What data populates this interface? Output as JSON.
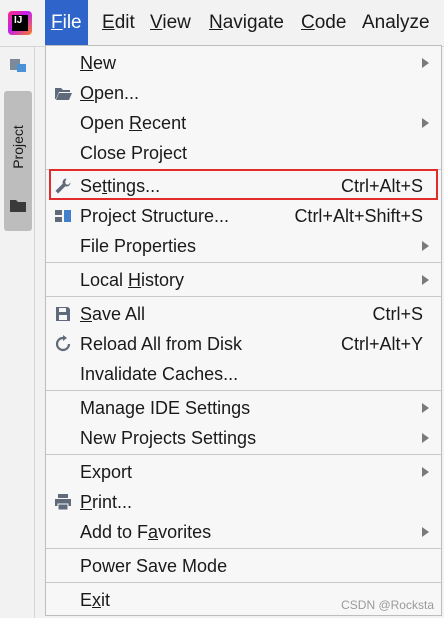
{
  "menubar": {
    "items": [
      {
        "label": "F",
        "rest": "ile",
        "active": true
      },
      {
        "label": "E",
        "rest": "dit",
        "active": false
      },
      {
        "label": "V",
        "rest": "iew",
        "active": false
      },
      {
        "label": "N",
        "rest": "avigate",
        "active": false
      },
      {
        "label": "C",
        "rest": "ode",
        "active": false
      },
      {
        "label": "",
        "rest": "Analyze",
        "active": false
      }
    ]
  },
  "sidebar": {
    "project_tab_label": "Project"
  },
  "file_menu": {
    "items": [
      {
        "pre": "",
        "mn": "N",
        "post": "ew",
        "shortcut": "",
        "submenu": true,
        "icon": ""
      },
      {
        "pre": "",
        "mn": "O",
        "post": "pen...",
        "shortcut": "",
        "submenu": false,
        "icon": "open-folder-icon"
      },
      {
        "pre": "Open ",
        "mn": "R",
        "post": "ecent",
        "shortcut": "",
        "submenu": true,
        "icon": ""
      },
      {
        "pre": "Close Project",
        "mn": "",
        "post": "",
        "shortcut": "",
        "submenu": false,
        "icon": ""
      },
      {
        "pre": "Se",
        "mn": "t",
        "post": "tings...",
        "shortcut": "Ctrl+Alt+S",
        "submenu": false,
        "icon": "wrench-icon"
      },
      {
        "pre": "Project Structure...",
        "mn": "",
        "post": "",
        "shortcut": "Ctrl+Alt+Shift+S",
        "submenu": false,
        "icon": "project-structure-icon"
      },
      {
        "pre": "File Properties",
        "mn": "",
        "post": "",
        "shortcut": "",
        "submenu": true,
        "icon": ""
      },
      {
        "pre": "Local ",
        "mn": "H",
        "post": "istory",
        "shortcut": "",
        "submenu": true,
        "icon": ""
      },
      {
        "pre": "",
        "mn": "S",
        "post": "ave All",
        "shortcut": "Ctrl+S",
        "submenu": false,
        "icon": "save-icon"
      },
      {
        "pre": "Reload All from Disk",
        "mn": "",
        "post": "",
        "shortcut": "Ctrl+Alt+Y",
        "submenu": false,
        "icon": "reload-icon"
      },
      {
        "pre": "Invalidate Caches...",
        "mn": "",
        "post": "",
        "shortcut": "",
        "submenu": false,
        "icon": ""
      },
      {
        "pre": "Manage IDE Settings",
        "mn": "",
        "post": "",
        "shortcut": "",
        "submenu": true,
        "icon": ""
      },
      {
        "pre": "New Projects Settings",
        "mn": "",
        "post": "",
        "shortcut": "",
        "submenu": true,
        "icon": ""
      },
      {
        "pre": "Export",
        "mn": "",
        "post": "",
        "shortcut": "",
        "submenu": true,
        "icon": ""
      },
      {
        "pre": "",
        "mn": "P",
        "post": "rint...",
        "shortcut": "",
        "submenu": false,
        "icon": "printer-icon"
      },
      {
        "pre": "Add to F",
        "mn": "a",
        "post": "vorites",
        "shortcut": "",
        "submenu": true,
        "icon": ""
      },
      {
        "pre": "Power Save Mode",
        "mn": "",
        "post": "",
        "shortcut": "",
        "submenu": false,
        "icon": ""
      },
      {
        "pre": "E",
        "mn": "x",
        "post": "it",
        "shortcut": "",
        "submenu": false,
        "icon": ""
      }
    ]
  },
  "watermark": "CSDN @Rocksta",
  "colors": {
    "menu_active": "#2f65ca",
    "highlight_box": "#e22b2b",
    "icon": "#5f6b7a"
  }
}
